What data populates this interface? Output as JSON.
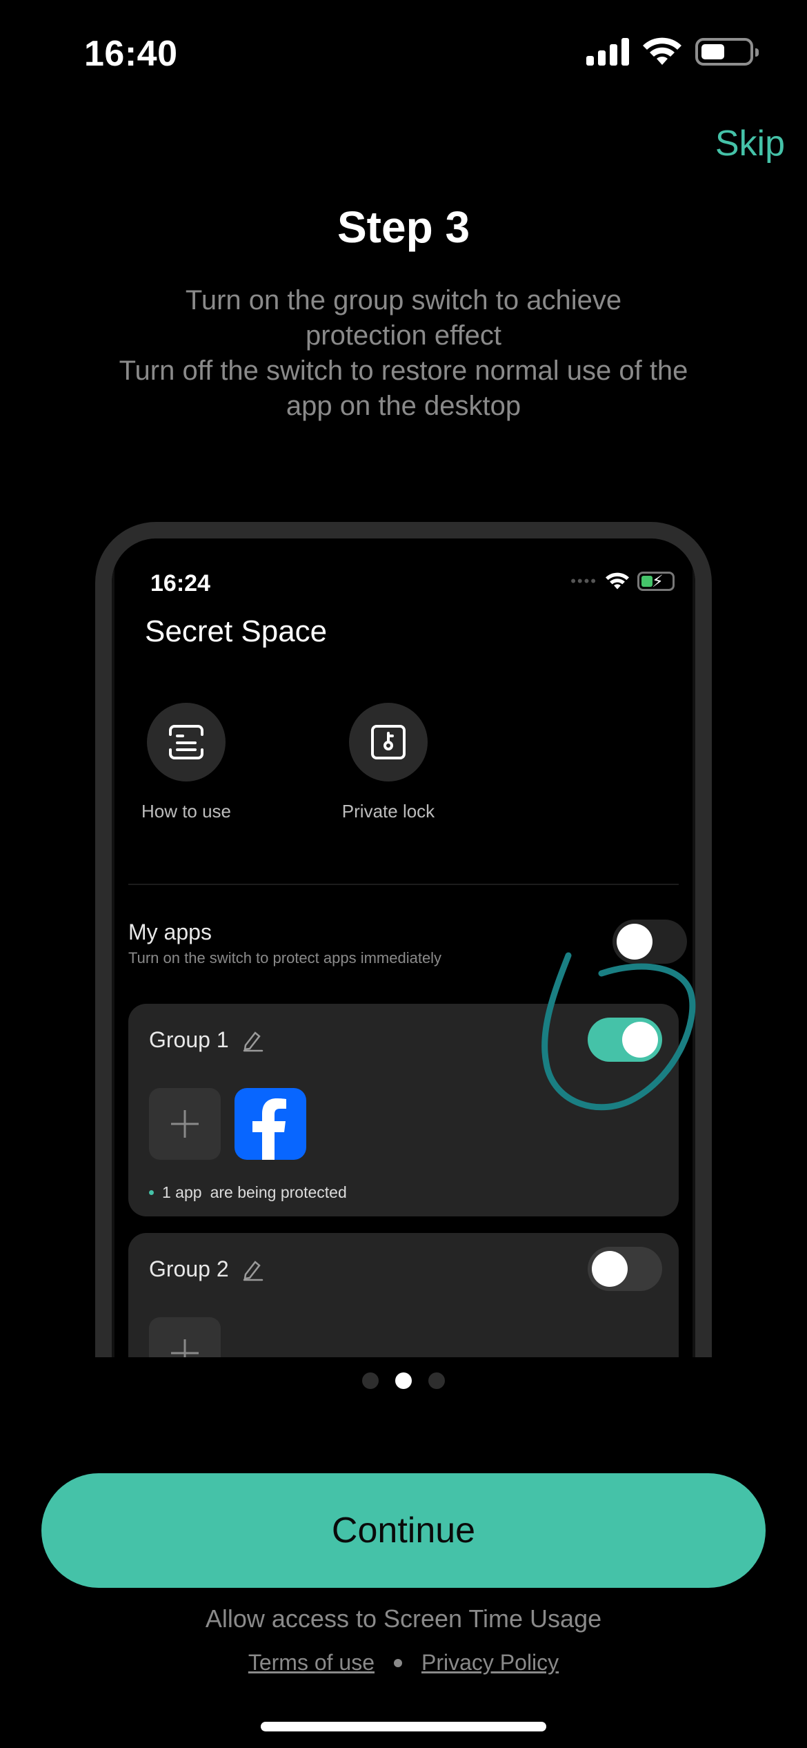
{
  "status_bar": {
    "time": "16:40",
    "battery_level": 0.5
  },
  "skip_label": "Skip",
  "step": {
    "title": "Step 3",
    "description_lines": [
      "Turn on the group switch to achieve",
      "protection effect",
      "Turn off the switch to restore normal use of the",
      "app on the desktop"
    ]
  },
  "mockup": {
    "status_time": "16:24",
    "title": "Secret Space",
    "quick_actions": [
      {
        "label": "How to use",
        "icon": "guide-icon"
      },
      {
        "label": "Private lock",
        "icon": "lock-icon"
      }
    ],
    "my_apps": {
      "title": "My apps",
      "subtitle": "Turn on the switch to protect apps immediately",
      "toggle_on": false
    },
    "groups": [
      {
        "name": "Group 1",
        "toggle_on": true,
        "apps": [
          "facebook-icon"
        ],
        "count_label": "1 app",
        "status_label": "are being protected"
      },
      {
        "name": "Group 2",
        "toggle_on": false,
        "apps": []
      }
    ],
    "colors": {
      "accent": "#45c2a8",
      "card": "#252525",
      "annotation": "#1a7f83"
    }
  },
  "pager": {
    "count": 3,
    "active_index": 1
  },
  "continue_label": "Continue",
  "access_text": "Allow access to Screen Time Usage",
  "terms_label": "Terms of use",
  "privacy_label": "Privacy Policy"
}
